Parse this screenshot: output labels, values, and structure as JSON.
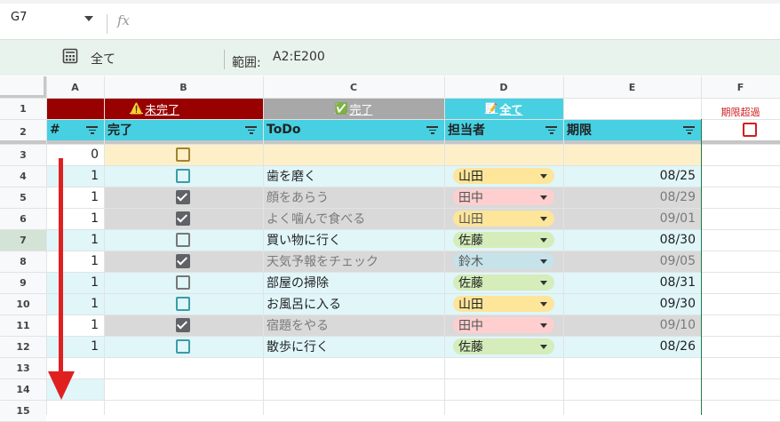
{
  "formula_bar": {
    "name_box": "G7",
    "fx_symbol": "fx"
  },
  "filter_bar": {
    "view_label": "全て",
    "range_label": "範囲:",
    "range_value": "A2:E200"
  },
  "columns": [
    "A",
    "B",
    "C",
    "D",
    "E",
    "F"
  ],
  "rows": [
    "1",
    "2",
    "3",
    "4",
    "5",
    "6",
    "7",
    "8",
    "9",
    "10",
    "11",
    "12",
    "13",
    "14",
    "15"
  ],
  "selected_row": "7",
  "row1": {
    "incomplete_icon": "⚠️",
    "incomplete_label": "未完了",
    "complete_icon": "✅",
    "complete_label": "完了",
    "all_icon": "📝",
    "all_label": "全て",
    "overdue_label": "期限超過"
  },
  "headers": {
    "num": "#",
    "done": "完了",
    "todo": "ToDo",
    "assignee": "担当者",
    "due": "期限"
  },
  "tasks": [
    {
      "num": "0",
      "done": false,
      "todo": "",
      "assignee": "",
      "due": ""
    },
    {
      "num": "1",
      "done": false,
      "todo": "歯を磨く",
      "assignee": "山田",
      "due": "08/25"
    },
    {
      "num": "1",
      "done": true,
      "todo": "顔をあらう",
      "assignee": "田中",
      "due": "08/29"
    },
    {
      "num": "1",
      "done": true,
      "todo": "よく噛んで食べる",
      "assignee": "山田",
      "due": "09/01"
    },
    {
      "num": "1",
      "done": false,
      "todo": "買い物に行く",
      "assignee": "佐藤",
      "due": "08/30"
    },
    {
      "num": "1",
      "done": true,
      "todo": "天気予報をチェック",
      "assignee": "鈴木",
      "due": "09/05"
    },
    {
      "num": "1",
      "done": false,
      "todo": "部屋の掃除",
      "assignee": "佐藤",
      "due": "08/31"
    },
    {
      "num": "1",
      "done": false,
      "todo": "お風呂に入る",
      "assignee": "山田",
      "due": "09/30"
    },
    {
      "num": "1",
      "done": true,
      "todo": "宿題をやる",
      "assignee": "田中",
      "due": "09/10"
    },
    {
      "num": "1",
      "done": false,
      "todo": "散歩に行く",
      "assignee": "佐藤",
      "due": "08/26"
    }
  ],
  "colors": {
    "header_cyan": "#46d0e2",
    "incomplete_red": "#990000",
    "complete_gray": "#a8a8a8",
    "row_light": "#e0f6f9",
    "row_done": "#d9d9d9",
    "row_template": "#fdf0c8",
    "chip_yamada": "#fde59a",
    "chip_tanaka": "#ffcfcf",
    "chip_sato": "#d4edbb",
    "chip_suzuki": "#c6e3ea",
    "arrow_red": "#e02020"
  },
  "icons": [
    "chevron-down-icon",
    "calculator-icon",
    "filter-icon",
    "down-arrow-icon",
    "checkbox-icon"
  ]
}
